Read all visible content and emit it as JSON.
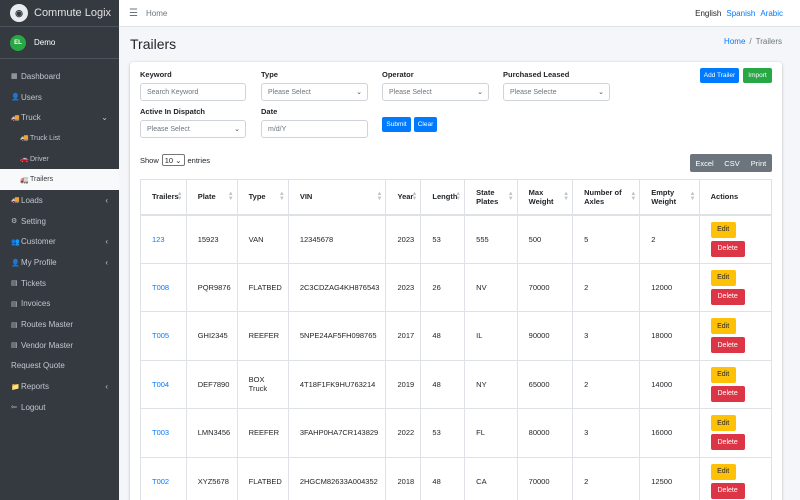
{
  "brand": {
    "name": "Commute Logix"
  },
  "user": {
    "name": "Demo",
    "avatar_text": "EL"
  },
  "sidebar": {
    "items": [
      {
        "label": "Dashboard",
        "icon": "dashboard-icon",
        "glyph": "▦",
        "sub": false,
        "arrow": ""
      },
      {
        "label": "Users",
        "icon": "user-icon",
        "glyph": "👤",
        "sub": false,
        "arrow": ""
      },
      {
        "label": "Truck",
        "icon": "truck-icon",
        "glyph": "🚚",
        "sub": false,
        "arrow": "⌄"
      },
      {
        "label": "Truck List",
        "icon": "truck-icon",
        "glyph": "🚚",
        "sub": true,
        "arrow": ""
      },
      {
        "label": "Driver",
        "icon": "car-icon",
        "glyph": "🚗",
        "sub": true,
        "arrow": ""
      },
      {
        "label": "Trailers",
        "icon": "trailer-icon",
        "glyph": "🚛",
        "sub": true,
        "arrow": "",
        "active": true
      },
      {
        "label": "Loads",
        "icon": "loads-icon",
        "glyph": "🚚",
        "sub": false,
        "arrow": "‹"
      },
      {
        "label": "Setting",
        "icon": "gear-icon",
        "glyph": "⚙",
        "sub": false,
        "arrow": ""
      },
      {
        "label": "Customer",
        "icon": "users-icon",
        "glyph": "👥",
        "sub": false,
        "arrow": "‹"
      },
      {
        "label": "My Profile",
        "icon": "user-icon",
        "glyph": "👤",
        "sub": false,
        "arrow": "‹"
      },
      {
        "label": "Tickets",
        "icon": "ticket-icon",
        "glyph": "▤",
        "sub": false,
        "arrow": ""
      },
      {
        "label": "Invoices",
        "icon": "invoice-icon",
        "glyph": "▤",
        "sub": false,
        "arrow": ""
      },
      {
        "label": "Routes Master",
        "icon": "routes-icon",
        "glyph": "▤",
        "sub": false,
        "arrow": ""
      },
      {
        "label": "Vendor Master",
        "icon": "vendor-icon",
        "glyph": "▤",
        "sub": false,
        "arrow": ""
      },
      {
        "label": "Request Quote",
        "icon": "",
        "glyph": "",
        "sub": false,
        "arrow": ""
      },
      {
        "label": "Reports",
        "icon": "folder-icon",
        "glyph": "📁",
        "sub": false,
        "arrow": "‹"
      },
      {
        "label": "Logout",
        "icon": "logout-icon",
        "glyph": "⇦",
        "sub": false,
        "arrow": ""
      }
    ]
  },
  "topbar": {
    "home": "Home",
    "languages": [
      "English",
      "Spanish",
      "Arabic"
    ]
  },
  "page": {
    "title": "Trailers",
    "breadcrumb": {
      "home": "Home",
      "current": "Trailers"
    }
  },
  "filters": {
    "keyword": {
      "label": "Keyword",
      "placeholder": "Search Keyword"
    },
    "type": {
      "label": "Type",
      "value": "Please Select"
    },
    "operator": {
      "label": "Operator",
      "value": "Please Select"
    },
    "purchased_leased": {
      "label": "Purchased Leased",
      "value": "Please Selecte"
    },
    "active_in_dispatch": {
      "label": "Active In Dispatch",
      "value": "Please Select"
    },
    "date": {
      "label": "Date",
      "placeholder": "m/d/Y"
    },
    "submit": "Submit",
    "clear": "Clear",
    "add_trailer": "Add Trailer",
    "import": "Import"
  },
  "table_controls": {
    "show": "Show",
    "entries_value": "10",
    "entries": "entries",
    "export": [
      "Excel",
      "CSV",
      "Print"
    ]
  },
  "table": {
    "headers": [
      "Trailers",
      "Plate",
      "Type",
      "VIN",
      "Year",
      "Length",
      "State Plates",
      "Max Weight",
      "Number of Axles",
      "Empty Weight",
      "Actions"
    ],
    "rows": [
      [
        "123",
        "15923",
        "VAN",
        "12345678",
        "2023",
        "53",
        "555",
        "500",
        "5",
        "2"
      ],
      [
        "T008",
        "PQR9876",
        "FLATBED",
        "2C3CDZAG4KH876543",
        "2023",
        "26",
        "NV",
        "70000",
        "2",
        "12000"
      ],
      [
        "T005",
        "GHI2345",
        "REEFER",
        "5NPE24AF5FH098765",
        "2017",
        "48",
        "IL",
        "90000",
        "3",
        "18000"
      ],
      [
        "T004",
        "DEF7890",
        "BOX Truck",
        "4T18F1FK9HU763214",
        "2019",
        "48",
        "NY",
        "65000",
        "2",
        "14000"
      ],
      [
        "T003",
        "LMN3456",
        "REEFER",
        "3FAHP0HA7CR143829",
        "2022",
        "53",
        "FL",
        "80000",
        "3",
        "16000"
      ],
      [
        "T002",
        "XYZ5678",
        "FLATBED",
        "2HGCM82633A004352",
        "2018",
        "48",
        "CA",
        "70000",
        "2",
        "12500"
      ]
    ],
    "edit": "Edit",
    "delete": "Delete"
  }
}
